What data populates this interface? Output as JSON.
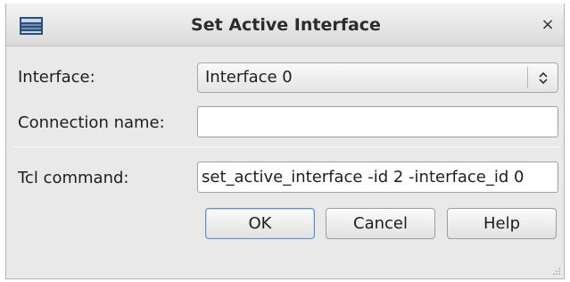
{
  "window": {
    "title": "Set Active Interface",
    "close_glyph": "×",
    "app_icon": "vivado-app-icon",
    "close_icon": "close-icon"
  },
  "form": {
    "interface_label": "Interface:",
    "interface_value": "Interface 0",
    "connection_name_label": "Connection name:",
    "connection_name_value": "",
    "tcl_command_label": "Tcl command:",
    "tcl_command_value": "set_active_interface -id 2 -interface_id 0"
  },
  "buttons": {
    "ok": "OK",
    "cancel": "Cancel",
    "help": "Help"
  },
  "colors": {
    "dialog_bg": "#e9e9e9",
    "default_button_border": "#6f8fb8"
  }
}
